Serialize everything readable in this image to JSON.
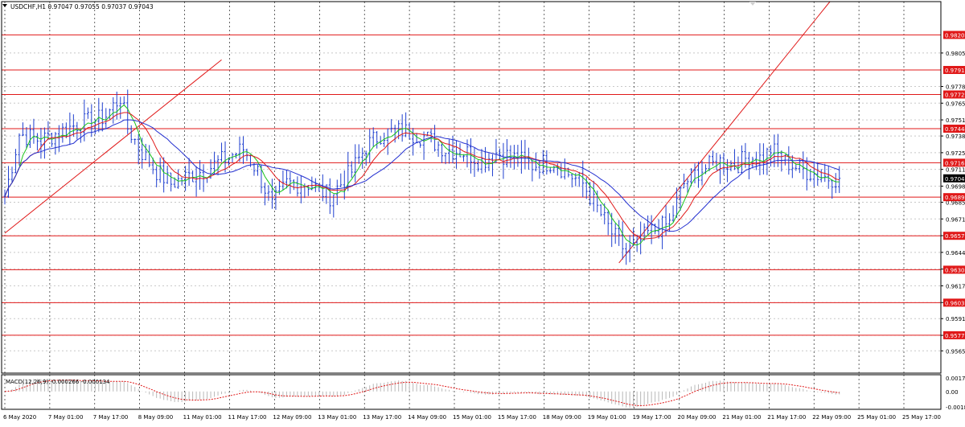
{
  "window": {
    "symbol_info": "USDCHF,H1  0.97047 0.97055 0.97037 0.97043",
    "menu_icon": "triangle-down-icon"
  },
  "colors": {
    "candle": "#1f3fcf",
    "ma_fast": "#19c419",
    "ma_mid": "#e01818",
    "ma_slow": "#2430d0",
    "level": "#e01818",
    "trendline": "#e01818",
    "macd_hist": "#b8b8b8",
    "macd_signal": "#e01818",
    "grid": "#c8c8c8",
    "price_tag_bg": "#e01818",
    "current_tag_bg": "#000000"
  },
  "chart_data": {
    "type": "candlestick",
    "title": "USDCHF,H1",
    "ylim": [
      0.9547,
      0.9847
    ],
    "price_ticks": [
      "0.98055",
      "0.97785",
      "0.97650",
      "0.97515",
      "0.97385",
      "0.97250",
      "0.97115",
      "0.96980",
      "0.96850",
      "0.96715",
      "0.96580",
      "0.96445",
      "0.96310",
      "0.96175",
      "0.96040",
      "0.95910",
      "0.95775",
      "0.95650"
    ],
    "level_lines": [
      0.98201,
      0.97918,
      0.9772,
      0.97444,
      0.97169,
      0.96891,
      0.96579,
      0.96305,
      0.96039,
      0.95776
    ],
    "level_labels": [
      "0.98201",
      "0.97918",
      "0.97720",
      "0.97444",
      "0.97169",
      "0.96891",
      "0.96579",
      "0.96305",
      "0.96039",
      "0.95776"
    ],
    "current_price": 0.97043,
    "current_price_label": "0.97043",
    "x_labels": [
      "6 May 2020",
      "7 May 01:00",
      "7 May 17:00",
      "8 May 09:00",
      "11 May 01:00",
      "11 May 17:00",
      "12 May 09:00",
      "13 May 01:00",
      "13 May 17:00",
      "14 May 09:00",
      "15 May 01:00",
      "15 May 17:00",
      "18 May 09:00",
      "19 May 01:00",
      "19 May 17:00",
      "20 May 09:00",
      "21 May 01:00",
      "21 May 17:00",
      "22 May 09:00",
      "25 May 01:00",
      "25 May 17:00"
    ],
    "bar_count": 232,
    "key_closes": [
      [
        0,
        0.969
      ],
      [
        4,
        0.974
      ],
      [
        10,
        0.9735
      ],
      [
        20,
        0.9748
      ],
      [
        26,
        0.9752
      ],
      [
        28,
        0.9755
      ],
      [
        32,
        0.977
      ],
      [
        34,
        0.9745
      ],
      [
        38,
        0.9725
      ],
      [
        42,
        0.971
      ],
      [
        46,
        0.97
      ],
      [
        50,
        0.9705
      ],
      [
        56,
        0.9712
      ],
      [
        62,
        0.9722
      ],
      [
        66,
        0.9728
      ],
      [
        70,
        0.971
      ],
      [
        74,
        0.9682
      ],
      [
        78,
        0.97
      ],
      [
        84,
        0.97
      ],
      [
        90,
        0.969
      ],
      [
        96,
        0.971
      ],
      [
        100,
        0.973
      ],
      [
        104,
        0.974
      ],
      [
        110,
        0.9743
      ],
      [
        116,
        0.9738
      ],
      [
        122,
        0.9728
      ],
      [
        128,
        0.9725
      ],
      [
        132,
        0.9718
      ],
      [
        136,
        0.9725
      ],
      [
        140,
        0.9722
      ],
      [
        146,
        0.9715
      ],
      [
        152,
        0.9718
      ],
      [
        156,
        0.9708
      ],
      [
        160,
        0.97
      ],
      [
        164,
        0.968
      ],
      [
        168,
        0.966
      ],
      [
        172,
        0.9645
      ],
      [
        174,
        0.9648
      ],
      [
        178,
        0.966
      ],
      [
        184,
        0.9668
      ],
      [
        188,
        0.97
      ],
      [
        192,
        0.971
      ],
      [
        198,
        0.9718
      ],
      [
        202,
        0.9715
      ],
      [
        206,
        0.9722
      ],
      [
        210,
        0.972
      ],
      [
        212,
        0.9728
      ],
      [
        216,
        0.9718
      ],
      [
        220,
        0.9712
      ],
      [
        224,
        0.9708
      ],
      [
        228,
        0.9705
      ],
      [
        231,
        0.97043
      ]
    ],
    "moving_averages": [
      {
        "name": "ma_fast",
        "period": 5
      },
      {
        "name": "ma_mid",
        "period": 10
      },
      {
        "name": "ma_slow",
        "period": 20
      }
    ],
    "trendlines": [
      {
        "from": [
          0,
          0.966
        ],
        "to": [
          60,
          0.98
        ]
      },
      {
        "from": [
          170,
          0.9636
        ],
        "to": [
          232,
          0.986
        ]
      }
    ],
    "indicator": {
      "label": "MACD(12,26,9) -0.000266 -0.000134",
      "y_ticks": [
        "0.001718",
        "0.00",
        "-0.00183"
      ],
      "ylim": [
        -0.00183,
        0.001718
      ]
    }
  }
}
